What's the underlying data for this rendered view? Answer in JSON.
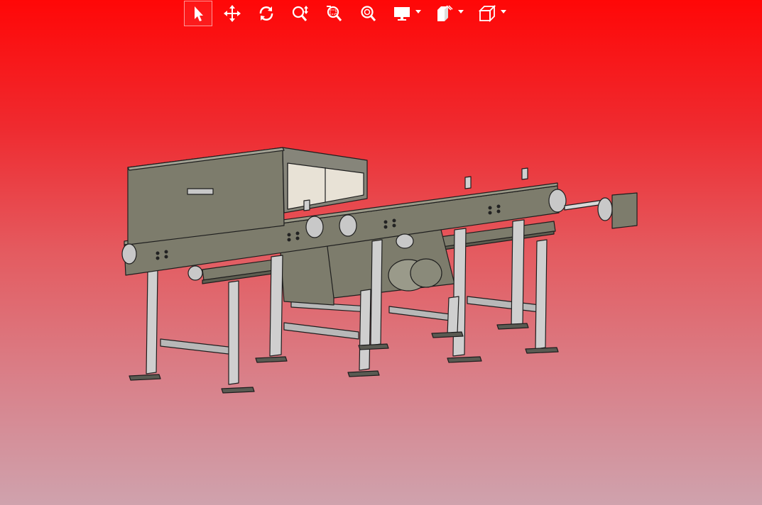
{
  "toolbar": {
    "tools": [
      {
        "icon": "select-arrow-icon",
        "active": true
      },
      {
        "icon": "pan-move-icon",
        "active": false
      },
      {
        "icon": "rotate-icon",
        "active": false
      },
      {
        "icon": "zoom-in-out-icon",
        "active": false
      },
      {
        "icon": "zoom-window-icon",
        "active": false
      },
      {
        "icon": "zoom-fit-icon",
        "active": false
      },
      {
        "icon": "display-monitor-icon",
        "dropdown": true
      },
      {
        "icon": "section-cube-icon",
        "dropdown": true
      },
      {
        "icon": "view-cube-icon",
        "dropdown": true
      }
    ]
  },
  "viewport": {
    "background_top": "#ff0707",
    "background_bottom": "#cfa2ad",
    "model_face_color": "#7d7c6c",
    "model_edge_color": "#1e1e1e",
    "model_metal_color": "#c9c9c9"
  }
}
